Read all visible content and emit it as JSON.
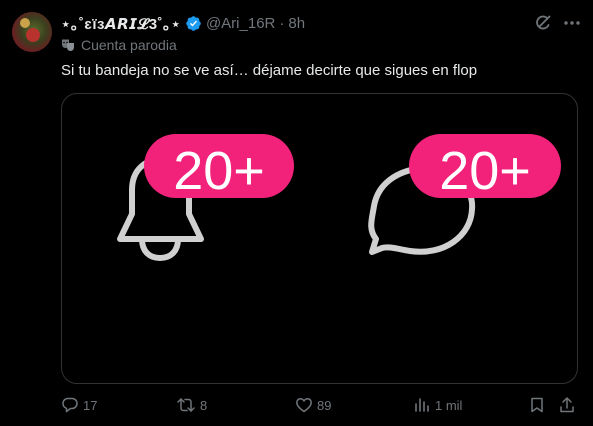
{
  "tweet": {
    "display_name": "⋆｡˚ɛïɜ𝘼𝙍𝙄𝓛3˚｡⋆",
    "handle": "@Ari_16R",
    "separator": "·",
    "time": "8h",
    "parody_label": "Cuenta parodia",
    "text": "Si tu bandeja no se ve así… déjame decirte que sigues en flop",
    "media": {
      "bell_badge": "20+",
      "message_badge": "20+",
      "badge_color": "#f2227b",
      "icon_color": "#d0d0d0"
    }
  },
  "actions": {
    "replies": "17",
    "reposts": "8",
    "likes": "89",
    "views": "1 mil"
  },
  "colors": {
    "background": "#000000",
    "text": "#e7e9ea",
    "muted": "#71767b",
    "verified": "#1d9bf0"
  }
}
